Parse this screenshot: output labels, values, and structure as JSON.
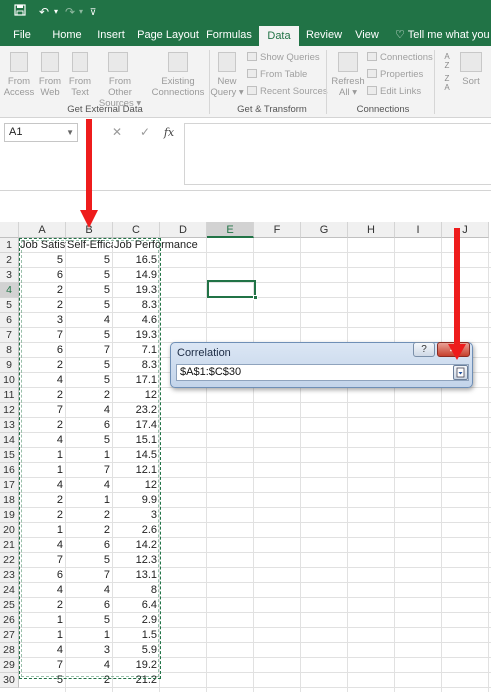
{
  "tabs": [
    {
      "label": "File",
      "active": false
    },
    {
      "label": "Home",
      "active": false
    },
    {
      "label": "Insert",
      "active": false
    },
    {
      "label": "Page Layout",
      "active": false
    },
    {
      "label": "Formulas",
      "active": false
    },
    {
      "label": "Data",
      "active": true
    },
    {
      "label": "Review",
      "active": false
    },
    {
      "label": "View",
      "active": false
    }
  ],
  "tell_me": "Tell me what you wa",
  "ribbon": {
    "get_external_data": {
      "label": "Get External Data",
      "buttons": [
        {
          "line1": "From",
          "line2": "Access"
        },
        {
          "line1": "From",
          "line2": "Web"
        },
        {
          "line1": "From",
          "line2": "Text"
        },
        {
          "line1": "From Other",
          "line2": "Sources ▾"
        },
        {
          "line1": "Existing",
          "line2": "Connections"
        }
      ]
    },
    "get_transform": {
      "label": "Get & Transform",
      "new_query": {
        "line1": "New",
        "line2": "Query ▾"
      },
      "items": [
        "Show Queries",
        "From Table",
        "Recent Sources"
      ]
    },
    "connections": {
      "label": "Connections",
      "refresh": {
        "line1": "Refresh",
        "line2": "All ▾"
      },
      "items": [
        "Connections",
        "Properties",
        "Edit Links"
      ]
    },
    "sort": {
      "label": "Sort"
    }
  },
  "formula_bar": {
    "name_box": "A1",
    "cancel": "✕",
    "enter": "✓",
    "fx": "fx",
    "value": ""
  },
  "sheet": {
    "columns": [
      "A",
      "B",
      "C",
      "D",
      "E",
      "F",
      "G",
      "H",
      "I",
      "J"
    ],
    "selected_column": "E",
    "selected_row": 4,
    "headers": [
      "Job Satisfaction",
      "Self-Efficacy",
      "Job Performance"
    ],
    "rows": [
      [
        5,
        5,
        16.5
      ],
      [
        6,
        5,
        14.9
      ],
      [
        2,
        5,
        19.3
      ],
      [
        2,
        5,
        8.3
      ],
      [
        3,
        4,
        4.6
      ],
      [
        7,
        5,
        19.3
      ],
      [
        6,
        7,
        7.1
      ],
      [
        2,
        5,
        8.3
      ],
      [
        4,
        5,
        17.1
      ],
      [
        2,
        2,
        12
      ],
      [
        7,
        4,
        23.2
      ],
      [
        2,
        6,
        17.4
      ],
      [
        4,
        5,
        15.1
      ],
      [
        1,
        1,
        14.5
      ],
      [
        1,
        7,
        12.1
      ],
      [
        4,
        4,
        12
      ],
      [
        2,
        1,
        9.9
      ],
      [
        2,
        2,
        3
      ],
      [
        1,
        2,
        2.6
      ],
      [
        4,
        6,
        14.2
      ],
      [
        7,
        5,
        12.3
      ],
      [
        6,
        7,
        13.1
      ],
      [
        4,
        4,
        8
      ],
      [
        2,
        6,
        6.4
      ],
      [
        1,
        5,
        2.9
      ],
      [
        1,
        1,
        1.5
      ],
      [
        4,
        3,
        5.9
      ],
      [
        7,
        4,
        19.2
      ],
      [
        5,
        2,
        21.2
      ]
    ]
  },
  "dialog": {
    "title": "Correlation",
    "help": "?",
    "close": "✕",
    "range_value": "$A$1:$C$30"
  }
}
